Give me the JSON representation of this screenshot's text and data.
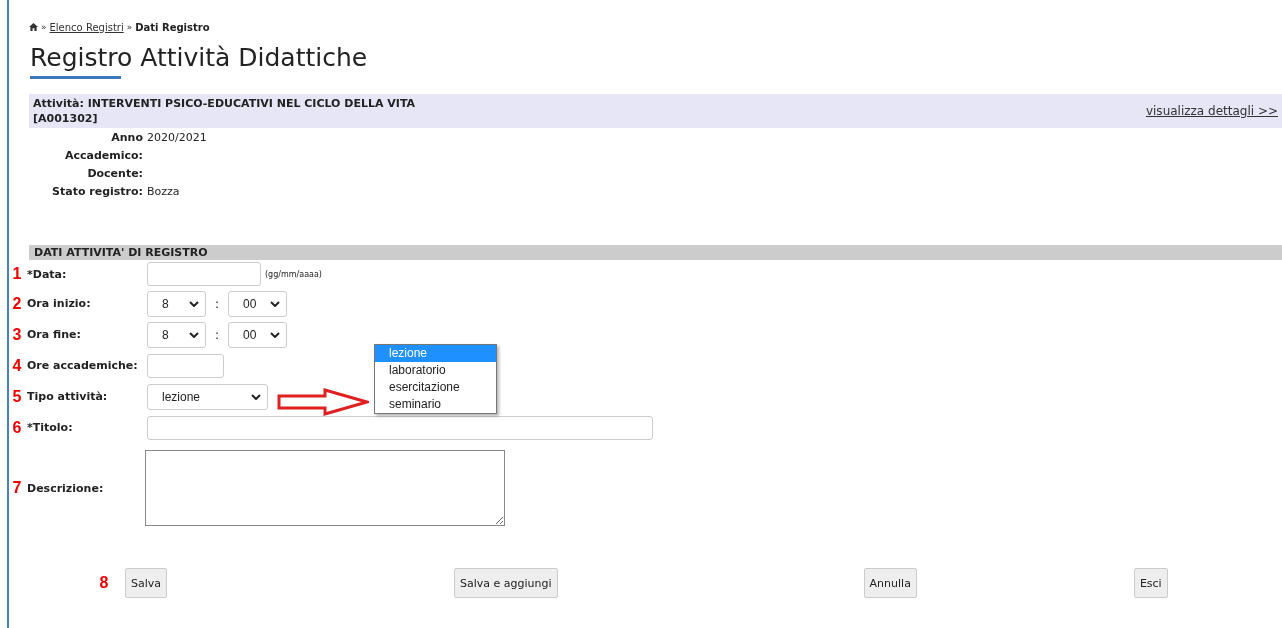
{
  "breadcrumb": {
    "separators": [
      "»",
      "»"
    ],
    "links": [
      "Elenco Registri"
    ],
    "current": "Dati Registro"
  },
  "page_title": "Registro Attività Didattiche",
  "activity": {
    "title": "Attività: INTERVENTI PSICO-EDUCATIVI NEL CICLO DELLA VITA",
    "code": "[A001302]",
    "details_link": "visualizza dettagli >>"
  },
  "info": [
    {
      "label": "Anno",
      "value": "2020/2021"
    },
    {
      "label": "Accademico:"
    },
    {
      "label": "Docente:"
    },
    {
      "label": "Stato registro:",
      "value": "Bozza"
    }
  ],
  "section_title": "DATI ATTIVITA' DI REGISTRO",
  "fields": [
    {
      "step": "1",
      "label": "*Data:",
      "kind": "date",
      "hint": "(gg/mm/aaaa)"
    },
    {
      "step": "2",
      "label": "Ora inizio:",
      "kind": "time",
      "hour": "8",
      "separator": ":",
      "minute": "00"
    },
    {
      "step": "3",
      "label": "Ora fine:",
      "kind": "time",
      "hour": "8",
      "separator": ":",
      "minute": "00"
    },
    {
      "step": "4",
      "label": "Ore accademiche:",
      "kind": "short"
    },
    {
      "step": "5",
      "label": "Tipo attività:",
      "kind": "select",
      "value": "lezione"
    },
    {
      "step": "6",
      "label": "*Titolo:",
      "kind": "long"
    },
    {
      "step": "7",
      "label": "Descrizione:",
      "kind": "textarea"
    }
  ],
  "dropdown_options": [
    {
      "label": "lezione",
      "selected": true
    },
    {
      "label": "laboratorio",
      "selected": false
    },
    {
      "label": "esercitazione",
      "selected": false
    },
    {
      "label": "seminario",
      "selected": false
    }
  ],
  "buttons_step": "8",
  "buttons": [
    "Salva",
    "Salva e aggiungi",
    "Annulla",
    "Esci"
  ]
}
